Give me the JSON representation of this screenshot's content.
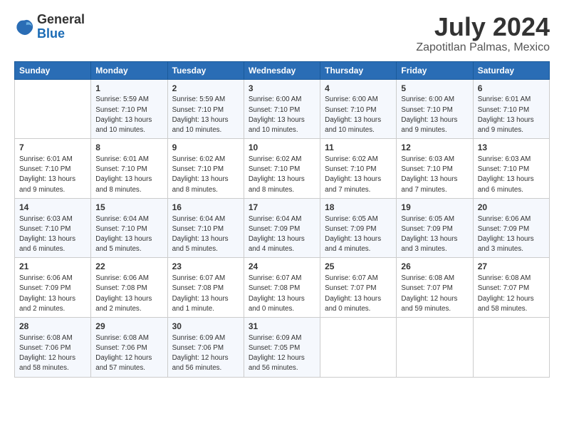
{
  "logo": {
    "line1": "General",
    "line2": "Blue"
  },
  "title": "July 2024",
  "subtitle": "Zapotitlan Palmas, Mexico",
  "headers": [
    "Sunday",
    "Monday",
    "Tuesday",
    "Wednesday",
    "Thursday",
    "Friday",
    "Saturday"
  ],
  "rows": [
    [
      {
        "day": "",
        "info": ""
      },
      {
        "day": "1",
        "info": "Sunrise: 5:59 AM\nSunset: 7:10 PM\nDaylight: 13 hours\nand 10 minutes."
      },
      {
        "day": "2",
        "info": "Sunrise: 5:59 AM\nSunset: 7:10 PM\nDaylight: 13 hours\nand 10 minutes."
      },
      {
        "day": "3",
        "info": "Sunrise: 6:00 AM\nSunset: 7:10 PM\nDaylight: 13 hours\nand 10 minutes."
      },
      {
        "day": "4",
        "info": "Sunrise: 6:00 AM\nSunset: 7:10 PM\nDaylight: 13 hours\nand 10 minutes."
      },
      {
        "day": "5",
        "info": "Sunrise: 6:00 AM\nSunset: 7:10 PM\nDaylight: 13 hours\nand 9 minutes."
      },
      {
        "day": "6",
        "info": "Sunrise: 6:01 AM\nSunset: 7:10 PM\nDaylight: 13 hours\nand 9 minutes."
      }
    ],
    [
      {
        "day": "7",
        "info": "Sunrise: 6:01 AM\nSunset: 7:10 PM\nDaylight: 13 hours\nand 9 minutes."
      },
      {
        "day": "8",
        "info": "Sunrise: 6:01 AM\nSunset: 7:10 PM\nDaylight: 13 hours\nand 8 minutes."
      },
      {
        "day": "9",
        "info": "Sunrise: 6:02 AM\nSunset: 7:10 PM\nDaylight: 13 hours\nand 8 minutes."
      },
      {
        "day": "10",
        "info": "Sunrise: 6:02 AM\nSunset: 7:10 PM\nDaylight: 13 hours\nand 8 minutes."
      },
      {
        "day": "11",
        "info": "Sunrise: 6:02 AM\nSunset: 7:10 PM\nDaylight: 13 hours\nand 7 minutes."
      },
      {
        "day": "12",
        "info": "Sunrise: 6:03 AM\nSunset: 7:10 PM\nDaylight: 13 hours\nand 7 minutes."
      },
      {
        "day": "13",
        "info": "Sunrise: 6:03 AM\nSunset: 7:10 PM\nDaylight: 13 hours\nand 6 minutes."
      }
    ],
    [
      {
        "day": "14",
        "info": "Sunrise: 6:03 AM\nSunset: 7:10 PM\nDaylight: 13 hours\nand 6 minutes."
      },
      {
        "day": "15",
        "info": "Sunrise: 6:04 AM\nSunset: 7:10 PM\nDaylight: 13 hours\nand 5 minutes."
      },
      {
        "day": "16",
        "info": "Sunrise: 6:04 AM\nSunset: 7:10 PM\nDaylight: 13 hours\nand 5 minutes."
      },
      {
        "day": "17",
        "info": "Sunrise: 6:04 AM\nSunset: 7:09 PM\nDaylight: 13 hours\nand 4 minutes."
      },
      {
        "day": "18",
        "info": "Sunrise: 6:05 AM\nSunset: 7:09 PM\nDaylight: 13 hours\nand 4 minutes."
      },
      {
        "day": "19",
        "info": "Sunrise: 6:05 AM\nSunset: 7:09 PM\nDaylight: 13 hours\nand 3 minutes."
      },
      {
        "day": "20",
        "info": "Sunrise: 6:06 AM\nSunset: 7:09 PM\nDaylight: 13 hours\nand 3 minutes."
      }
    ],
    [
      {
        "day": "21",
        "info": "Sunrise: 6:06 AM\nSunset: 7:09 PM\nDaylight: 13 hours\nand 2 minutes."
      },
      {
        "day": "22",
        "info": "Sunrise: 6:06 AM\nSunset: 7:08 PM\nDaylight: 13 hours\nand 2 minutes."
      },
      {
        "day": "23",
        "info": "Sunrise: 6:07 AM\nSunset: 7:08 PM\nDaylight: 13 hours\nand 1 minute."
      },
      {
        "day": "24",
        "info": "Sunrise: 6:07 AM\nSunset: 7:08 PM\nDaylight: 13 hours\nand 0 minutes."
      },
      {
        "day": "25",
        "info": "Sunrise: 6:07 AM\nSunset: 7:07 PM\nDaylight: 13 hours\nand 0 minutes."
      },
      {
        "day": "26",
        "info": "Sunrise: 6:08 AM\nSunset: 7:07 PM\nDaylight: 12 hours\nand 59 minutes."
      },
      {
        "day": "27",
        "info": "Sunrise: 6:08 AM\nSunset: 7:07 PM\nDaylight: 12 hours\nand 58 minutes."
      }
    ],
    [
      {
        "day": "28",
        "info": "Sunrise: 6:08 AM\nSunset: 7:06 PM\nDaylight: 12 hours\nand 58 minutes."
      },
      {
        "day": "29",
        "info": "Sunrise: 6:08 AM\nSunset: 7:06 PM\nDaylight: 12 hours\nand 57 minutes."
      },
      {
        "day": "30",
        "info": "Sunrise: 6:09 AM\nSunset: 7:06 PM\nDaylight: 12 hours\nand 56 minutes."
      },
      {
        "day": "31",
        "info": "Sunrise: 6:09 AM\nSunset: 7:05 PM\nDaylight: 12 hours\nand 56 minutes."
      },
      {
        "day": "",
        "info": ""
      },
      {
        "day": "",
        "info": ""
      },
      {
        "day": "",
        "info": ""
      }
    ]
  ]
}
